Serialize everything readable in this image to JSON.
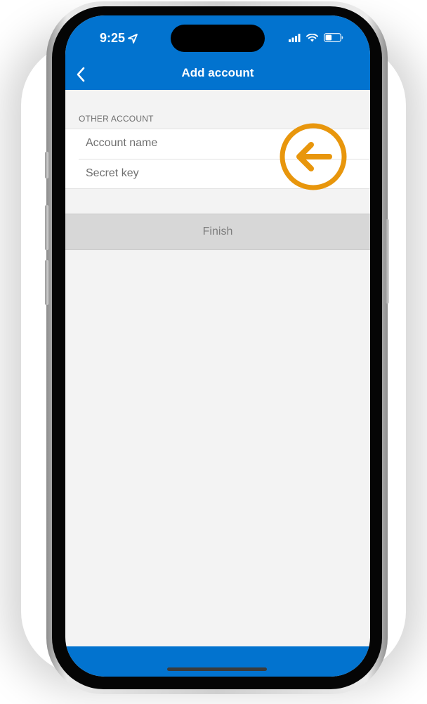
{
  "status_bar": {
    "time": "9:25",
    "icons": [
      "location-arrow-icon",
      "cellular-signal-icon",
      "wifi-icon",
      "battery-icon"
    ]
  },
  "nav": {
    "title": "Add account",
    "back_icon": "chevron-left-icon"
  },
  "form": {
    "section_header": "OTHER ACCOUNT",
    "fields": [
      {
        "placeholder": "Account name",
        "value": ""
      },
      {
        "placeholder": "Secret key",
        "value": ""
      }
    ],
    "finish_label": "Finish"
  },
  "annotation": {
    "icon": "arrow-left-circle-icon",
    "color": "#E8960C"
  },
  "colors": {
    "accent": "#0273CF",
    "background": "#F3F3F3",
    "disabled_button": "#D7D7D7"
  }
}
